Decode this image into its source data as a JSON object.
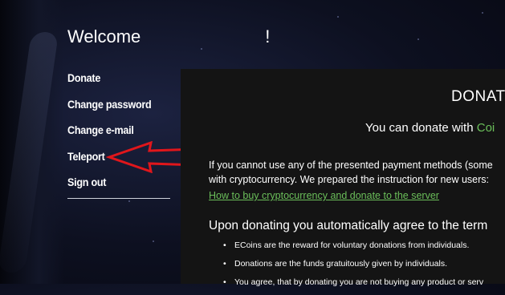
{
  "welcome": {
    "text": "Welcome",
    "exclamation": "!"
  },
  "menu": {
    "items": [
      {
        "label": "Donate"
      },
      {
        "label": "Change password"
      },
      {
        "label": "Change e-mail"
      },
      {
        "label": "Teleport"
      },
      {
        "label": "Sign out"
      }
    ]
  },
  "annotation": {
    "arrow_color": "#e0161b",
    "icon": "arrow-left-icon"
  },
  "panel": {
    "title": "DONAT",
    "subtitle_prefix": "You can donate with ",
    "subtitle_accent": "Coi",
    "info_line1": "If you cannot use any of the presented payment methods (some",
    "info_line2": "with cryptocurrency. We prepared the instruction for new users:",
    "info_link": "How to buy cryptocurrency and donate to the server",
    "agree_text": "Upon donating you automatically agree to the term",
    "terms": [
      "ECoins are the reward for voluntary donations from individuals.",
      "Donations are the funds gratuitously given by individuals.",
      "You agree, that by donating you are not buying any product or serv"
    ],
    "accent_color": "#6bbf5a",
    "background": "#141414"
  }
}
